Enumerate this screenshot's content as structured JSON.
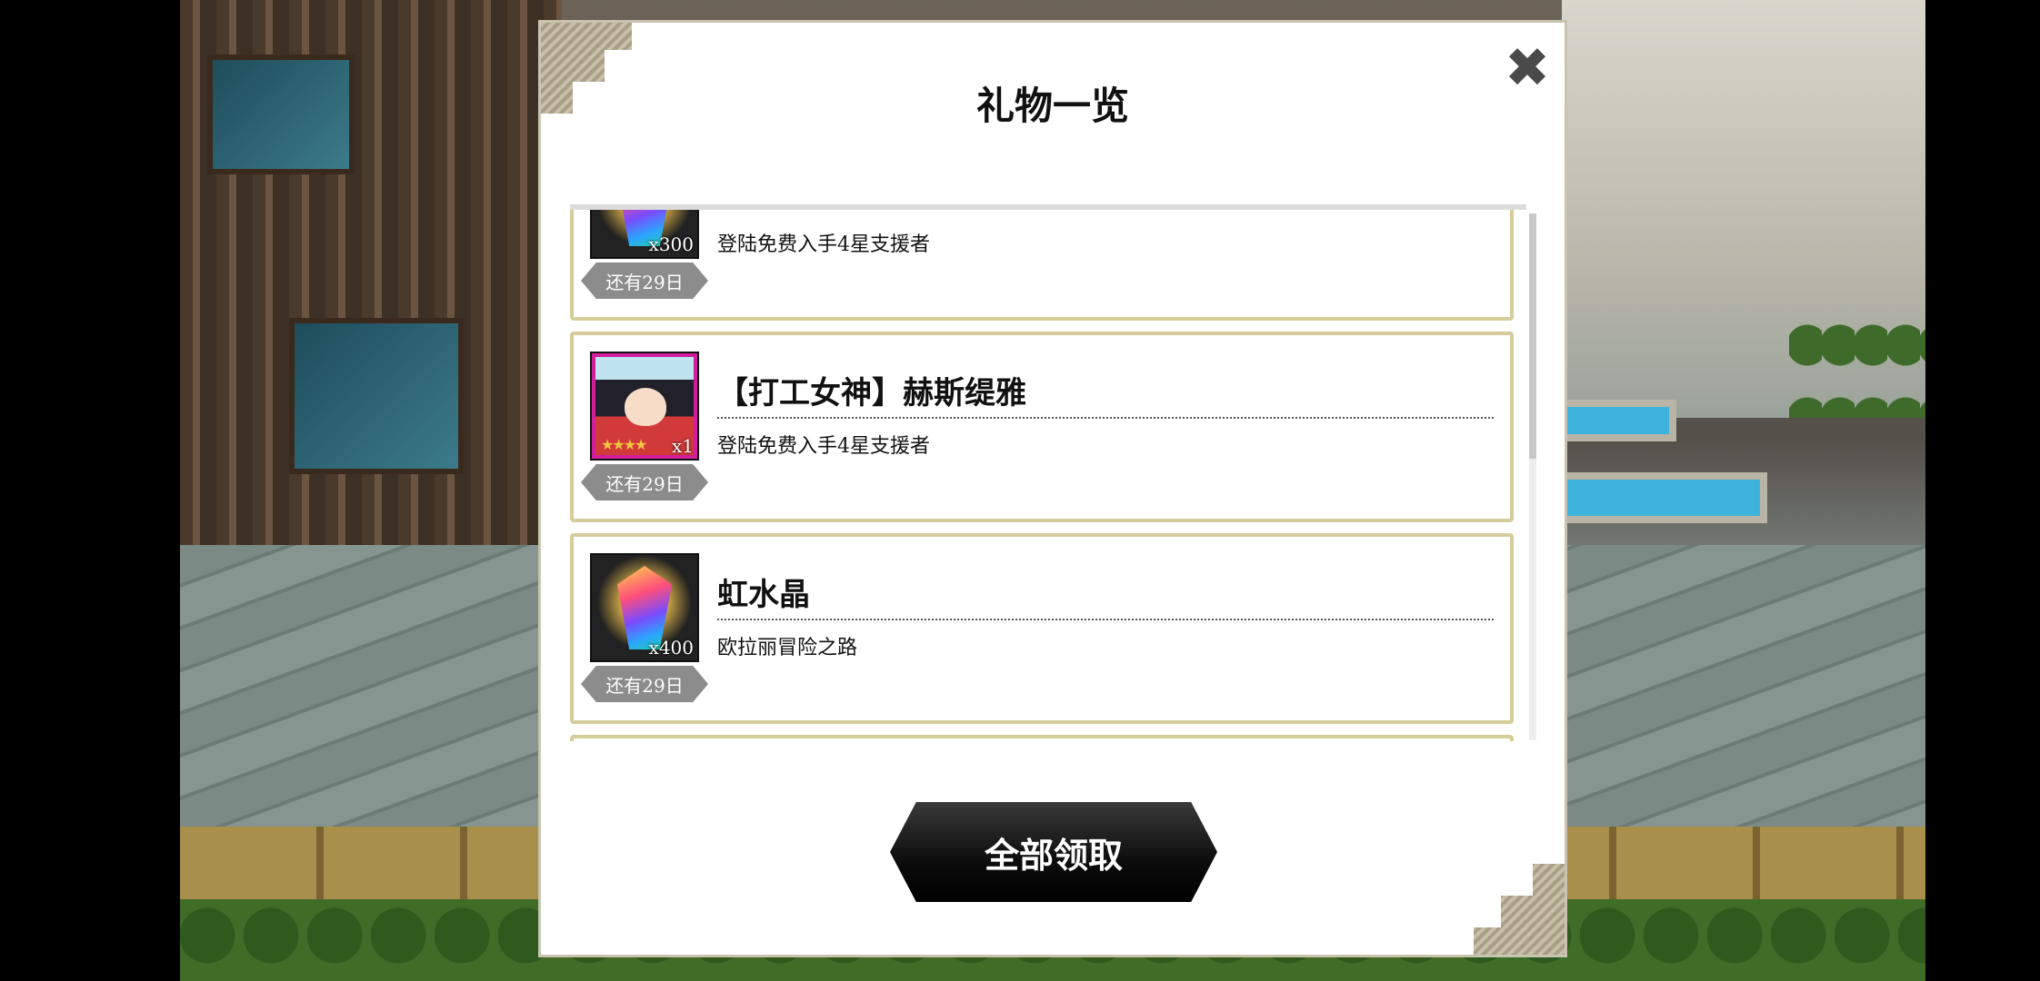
{
  "dialog": {
    "title": "礼物一览",
    "claim_all_label": "全部领取"
  },
  "gifts": [
    {
      "name": "",
      "description": "登陆免费入手4星支援者",
      "quantity": "x300",
      "days_left": "还有29日",
      "icon": "rainbow-crystal-icon"
    },
    {
      "name": "【打工女神】赫斯缇雅",
      "description": "登陆免费入手4星支援者",
      "quantity": "x1",
      "days_left": "还有29日",
      "icon": "character-portrait",
      "stars": "★★★★"
    },
    {
      "name": "虹水晶",
      "description": "欧拉丽冒险之路",
      "quantity": "x400",
      "days_left": "还有29日",
      "icon": "rainbow-crystal-icon"
    }
  ]
}
